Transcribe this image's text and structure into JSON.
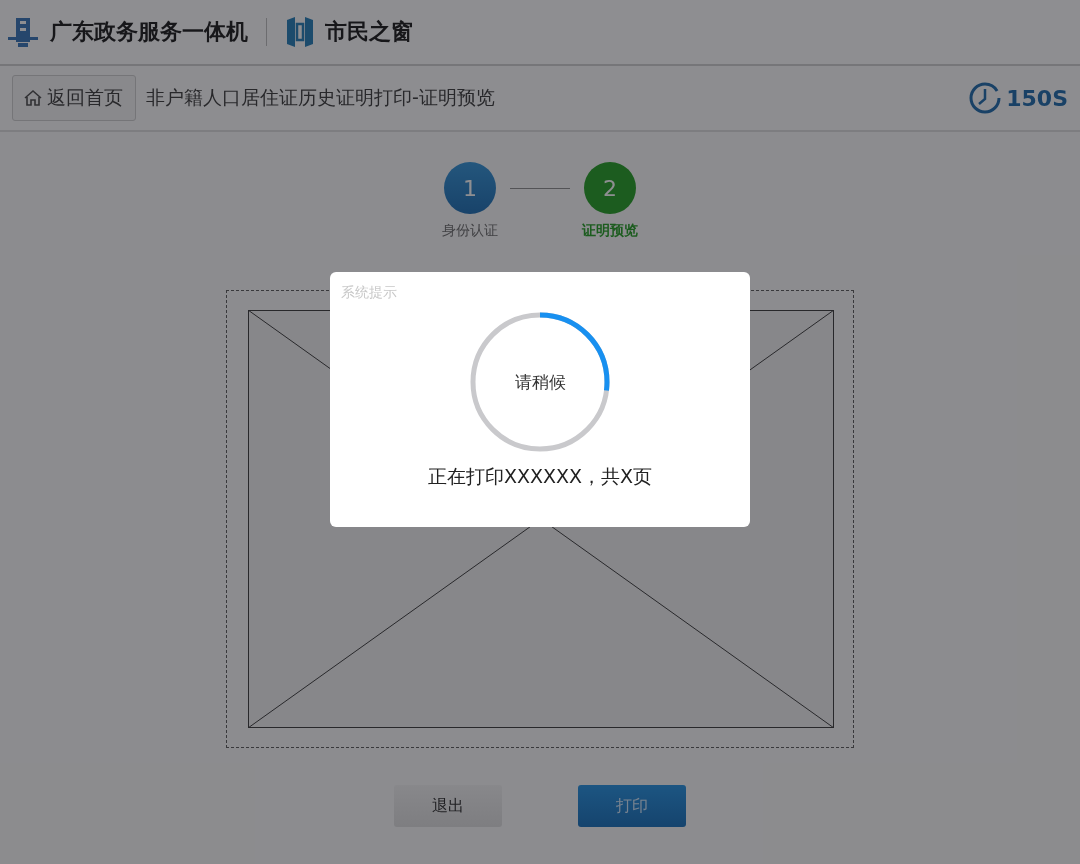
{
  "header": {
    "title": "广东政务服务一体机",
    "brand": "市民之窗"
  },
  "nav": {
    "home_button": "返回首页",
    "page_title": "非户籍人口居住证历史证明打印-证明预览",
    "countdown": "150S"
  },
  "steps": [
    {
      "number": "1",
      "label": "身份认证",
      "selected": false
    },
    {
      "number": "2",
      "label": "证明预览",
      "selected": true
    }
  ],
  "buttons": [
    {
      "label": "退出",
      "kind": "secondary"
    },
    {
      "label": "打印",
      "kind": "primary"
    }
  ],
  "dialog": {
    "title": "系统提示",
    "spinner_text": "请稍候",
    "level": 0.27,
    "message": "正在打印XXXXXX，共X页"
  }
}
